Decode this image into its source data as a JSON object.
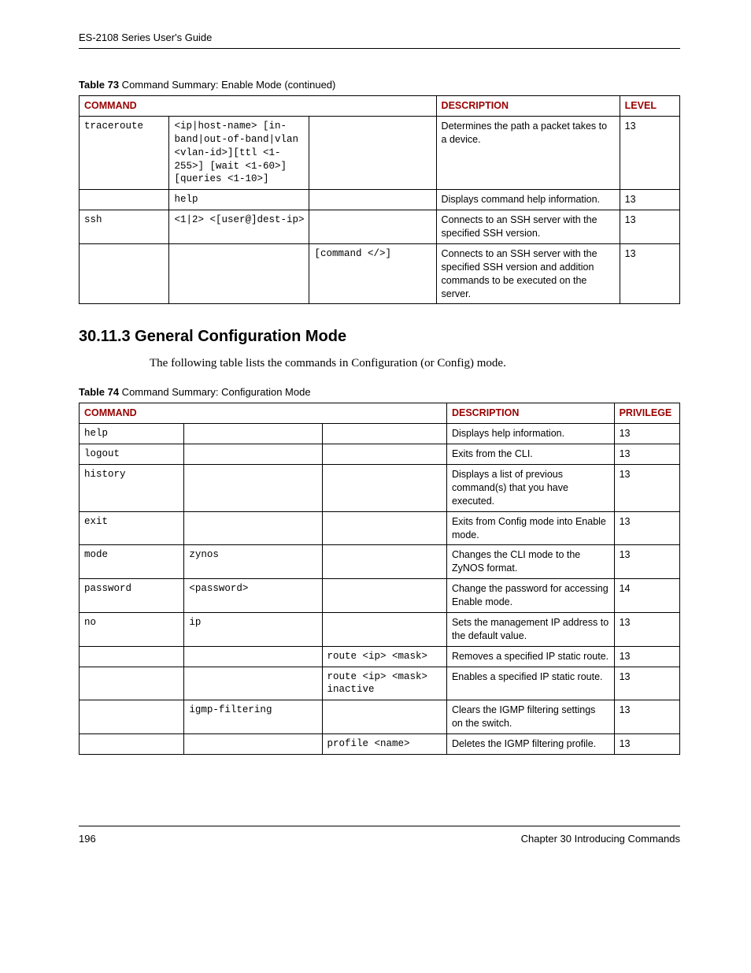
{
  "header": "ES-2108 Series User's Guide",
  "table73": {
    "caption_bold": "Table 73",
    "caption_rest": "   Command Summary: Enable Mode  (continued)",
    "headers": {
      "c1": "COMMAND",
      "c2": "DESCRIPTION",
      "c3": "LEVEL"
    },
    "rows": [
      {
        "c0": "traceroute",
        "c1": "<ip|host-name> [in-band|out-of-band|vlan <vlan-id>][ttl <1-255>] [wait <1-60>] [queries <1-10>]",
        "c2": "",
        "desc": "Determines the path a packet takes to a device.",
        "lvl": "13"
      },
      {
        "c0": "",
        "c1": "help",
        "c2": "",
        "desc": "Displays command help information.",
        "lvl": "13"
      },
      {
        "c0": "ssh",
        "c1": "<1|2> <[user@]dest-ip>",
        "c2": "",
        "desc": "Connects to an SSH server with the specified SSH version.",
        "lvl": "13"
      },
      {
        "c0": "",
        "c1": "",
        "c2": "[command </>]",
        "desc": "Connects to an SSH server with the specified SSH version and addition commands to be executed on the server.",
        "lvl": "13"
      }
    ]
  },
  "section_heading": "30.11.3  General Configuration Mode",
  "intro": "The following table lists the commands in Configuration (or Config) mode.",
  "table74": {
    "caption_bold": "Table 74",
    "caption_rest": "   Command Summary: Configuration Mode",
    "headers": {
      "c1": "COMMAND",
      "c2": "DESCRIPTION",
      "c3": "PRIVILEGE"
    },
    "rows": [
      {
        "c0": "help",
        "c1": "",
        "c2": "",
        "desc": "Displays help information.",
        "lvl": "13"
      },
      {
        "c0": "logout",
        "c1": "",
        "c2": "",
        "desc": "Exits from the CLI.",
        "lvl": "13"
      },
      {
        "c0": "history",
        "c1": "",
        "c2": "",
        "desc": "Displays a list of previous command(s) that you have executed.",
        "lvl": "13"
      },
      {
        "c0": "exit",
        "c1": "",
        "c2": "",
        "desc": "Exits from Config mode into Enable mode.",
        "lvl": "13"
      },
      {
        "c0": "mode",
        "c1": "zynos",
        "c2": "",
        "desc": "Changes the CLI mode to the ZyNOS format.",
        "lvl": "13"
      },
      {
        "c0": "password",
        "c1": "<password>",
        "c2": "",
        "desc": "Change the password for accessing Enable mode.",
        "lvl": "14"
      },
      {
        "c0": "no",
        "c1": "ip",
        "c2": "",
        "desc": "Sets the management IP address to the default value.",
        "lvl": "13"
      },
      {
        "c0": "",
        "c1": "",
        "c2": "route <ip> <mask>",
        "desc": "Removes a specified IP static route.",
        "lvl": "13"
      },
      {
        "c0": "",
        "c1": "",
        "c2": "route <ip> <mask> inactive",
        "desc": "Enables a specified IP static route.",
        "lvl": "13"
      },
      {
        "c0": "",
        "c1": "igmp-filtering",
        "c2": "",
        "desc": "Clears the IGMP filtering settings on the switch.",
        "lvl": "13"
      },
      {
        "c0": "",
        "c1": "",
        "c2": "profile <name>",
        "desc": "Deletes the IGMP filtering profile.",
        "lvl": "13"
      }
    ]
  },
  "footer": {
    "page": "196",
    "chapter": "Chapter 30 Introducing Commands"
  }
}
